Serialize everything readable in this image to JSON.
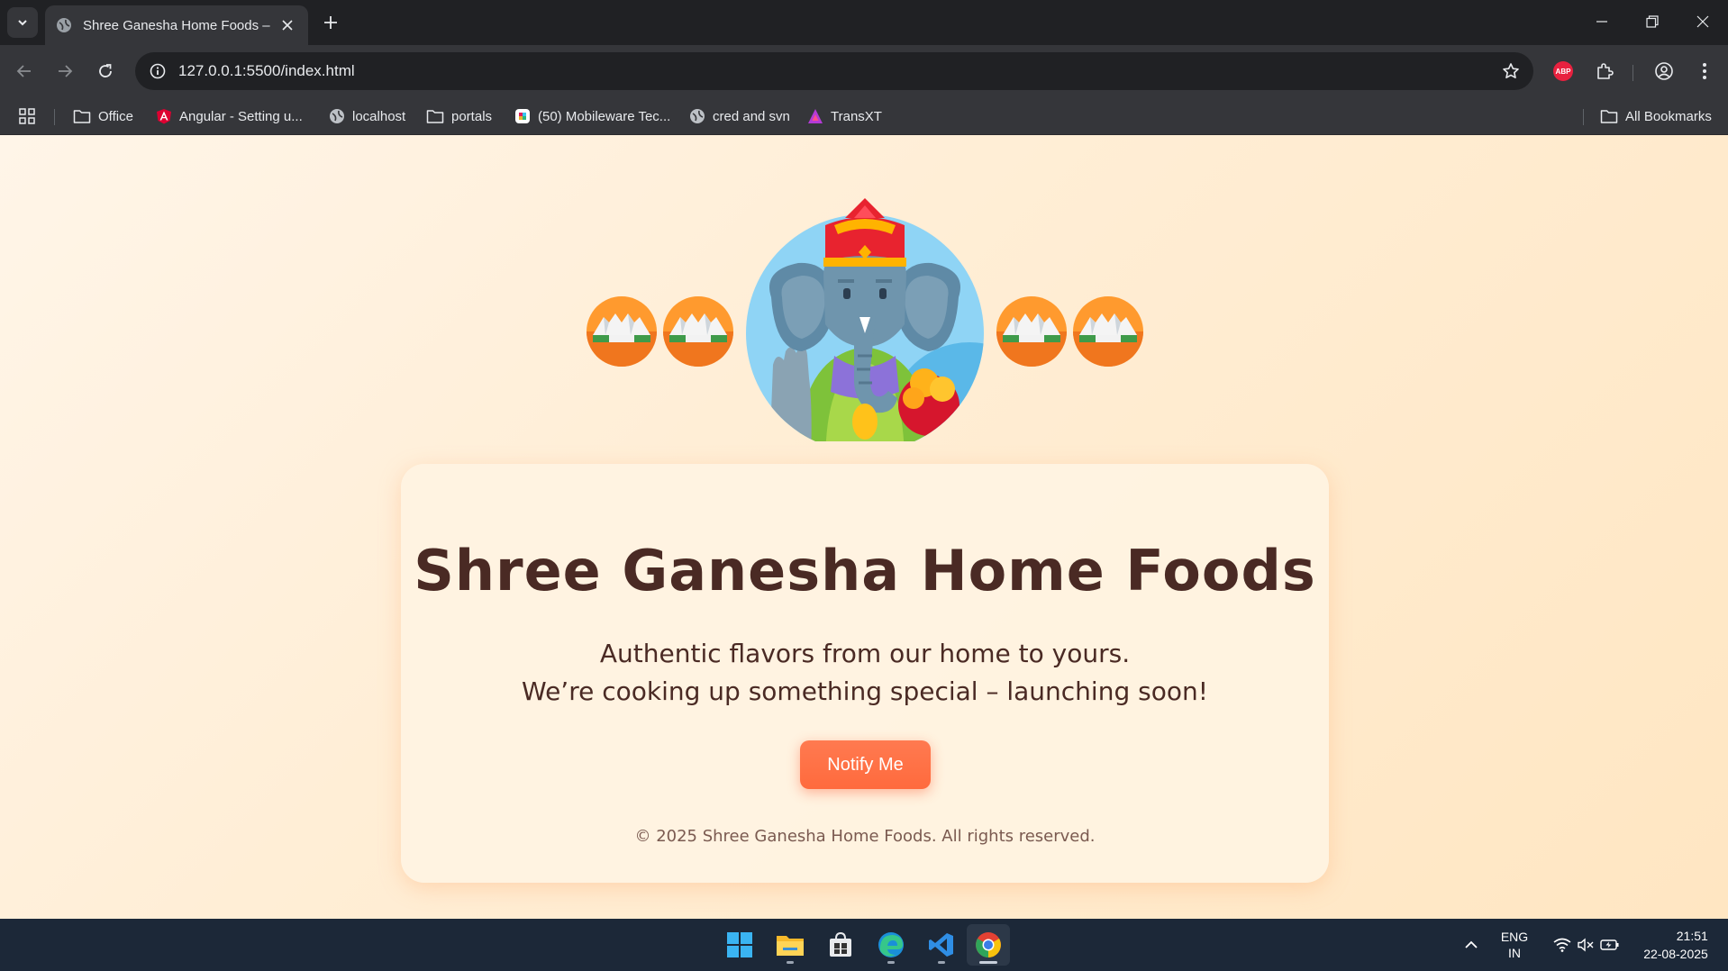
{
  "browser": {
    "tab_title": "Shree Ganesha Home Foods – C",
    "url": "127.0.0.1:5500/index.html",
    "bookmarks": [
      {
        "label": "Office",
        "icon": "folder-icon"
      },
      {
        "label": "Angular - Setting u...",
        "icon": "angular-icon"
      },
      {
        "label": "localhost",
        "icon": "globe-icon"
      },
      {
        "label": "portals",
        "icon": "folder-icon"
      },
      {
        "label": "(50) Mobileware Tec...",
        "icon": "chat-app-icon"
      },
      {
        "label": "cred and svn",
        "icon": "globe-icon"
      },
      {
        "label": "TransXT",
        "icon": "transxt-icon"
      }
    ],
    "all_bookmarks": "All Bookmarks",
    "extension_badge": "ABP"
  },
  "page": {
    "title": "Shree Ganesha Home Foods",
    "tagline_line1": "Authentic flavors from our home to yours.",
    "tagline_line2": "We’re cooking up something special – launching soon!",
    "notify_button": "Notify Me",
    "footer": "© 2025 Shree Ganesha Home Foods. All rights reserved.",
    "colors": {
      "background": "#ffeed6",
      "title_text": "#4a2a24",
      "button": "#ff6a3d"
    }
  },
  "taskbar": {
    "apps": [
      "start-icon",
      "file-explorer-icon",
      "store-icon",
      "edge-icon",
      "vscode-icon",
      "chrome-icon"
    ],
    "language_line1": "ENG",
    "language_line2": "IN",
    "time": "21:51",
    "date": "22-08-2025"
  }
}
